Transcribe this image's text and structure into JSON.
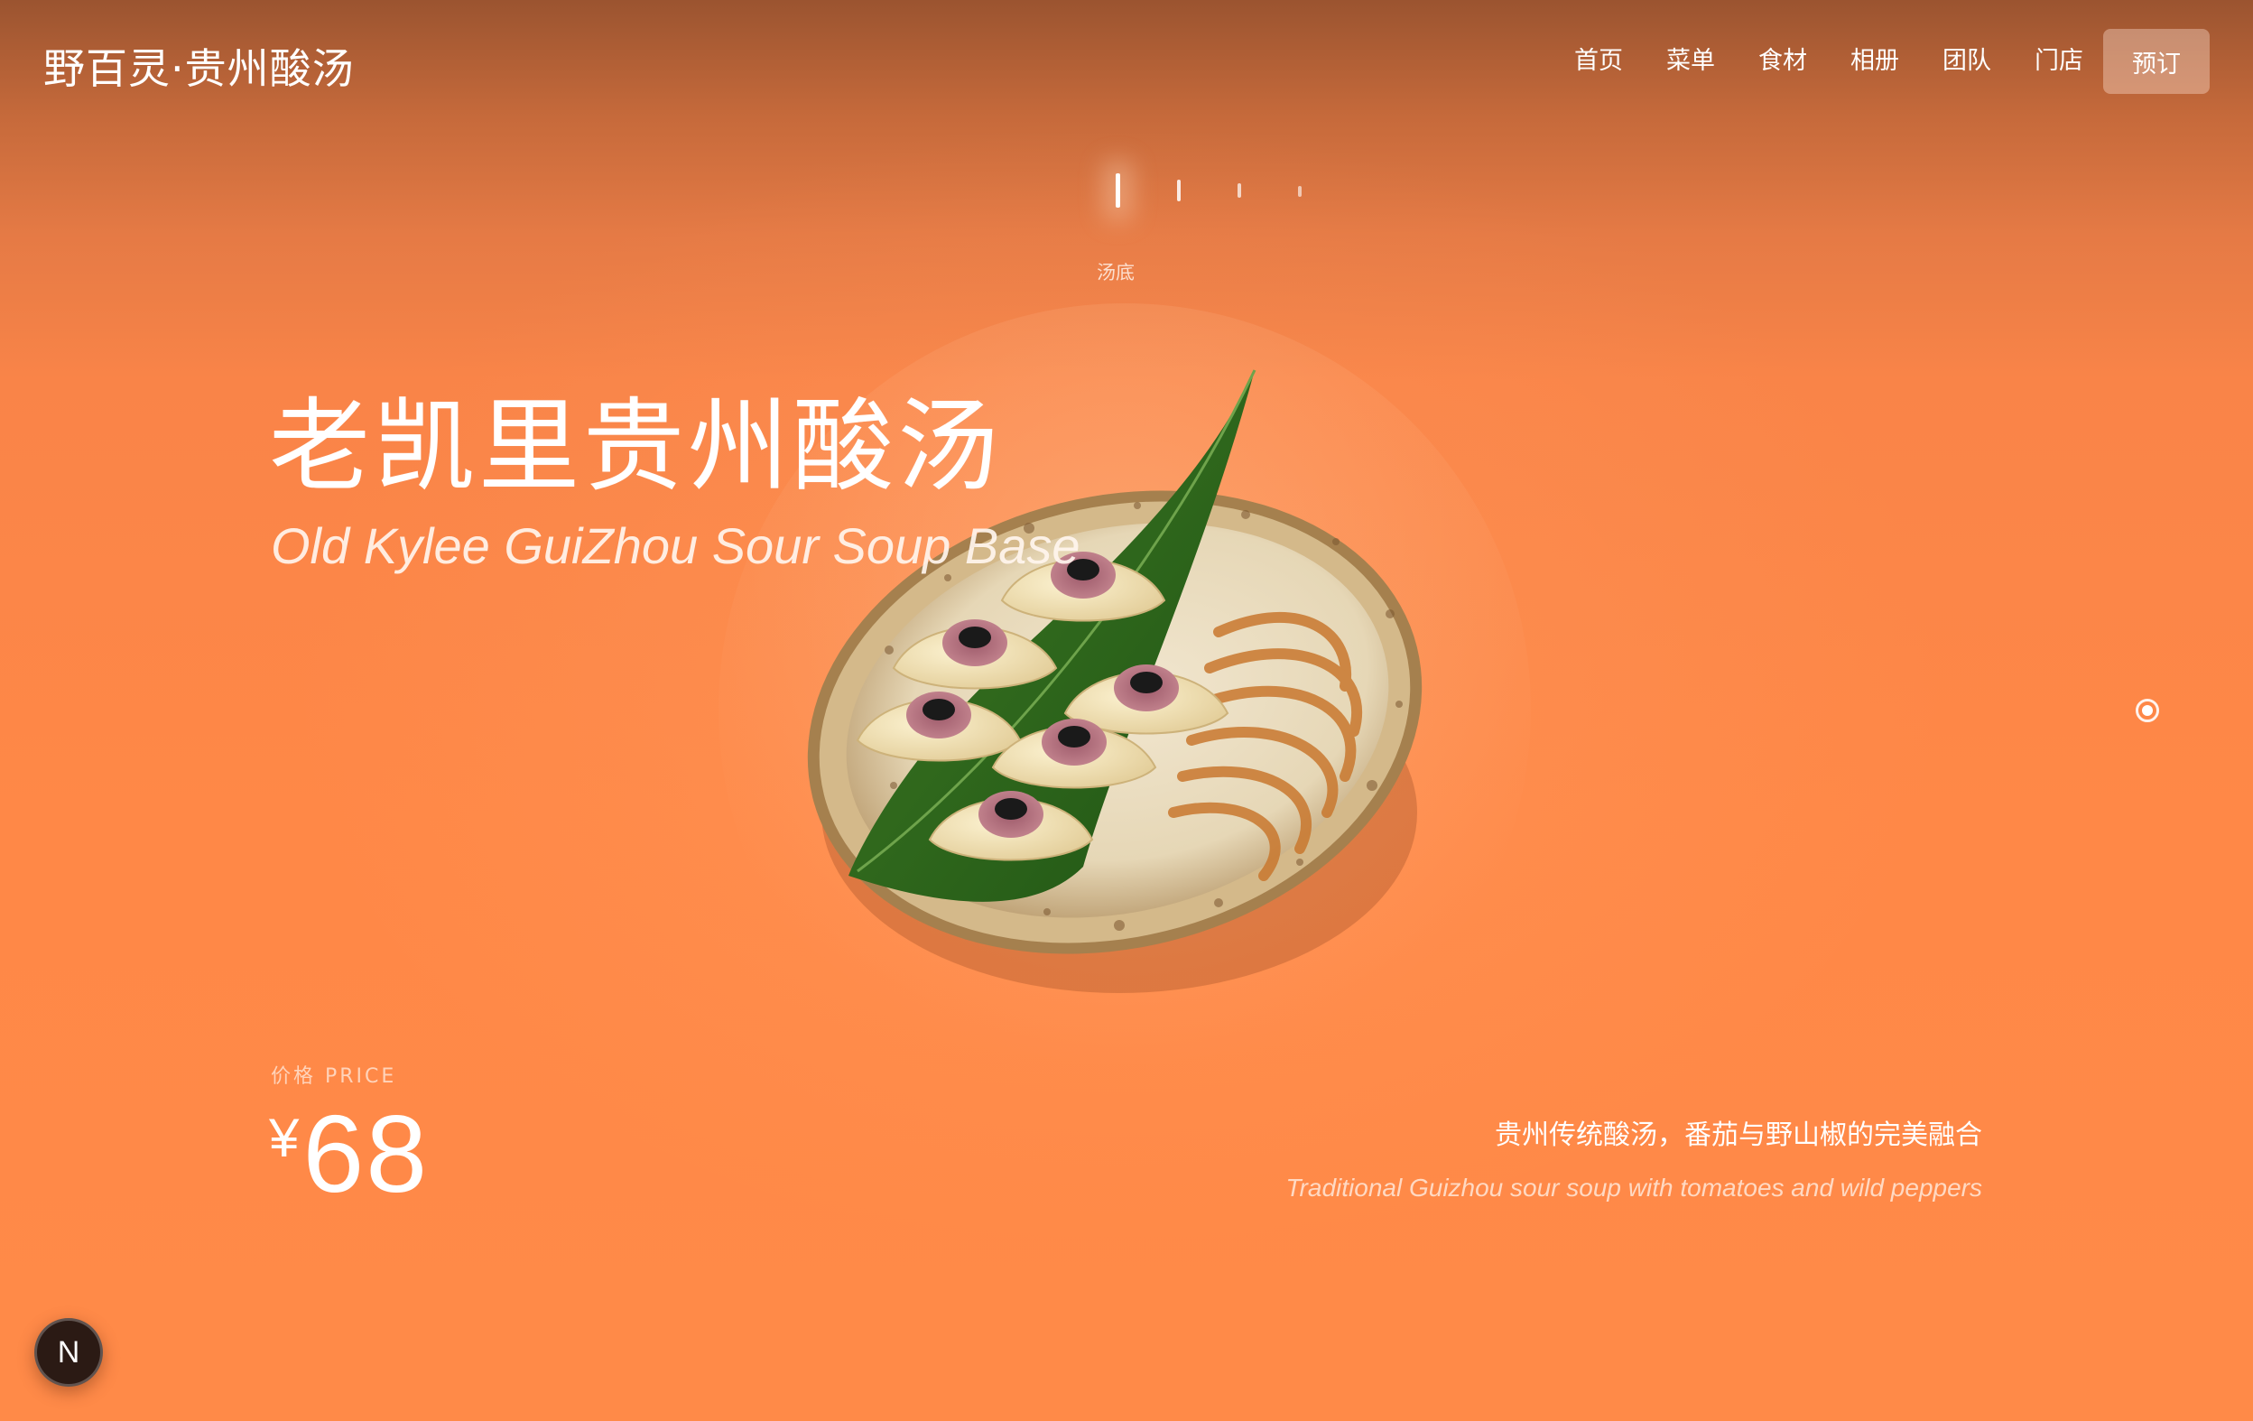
{
  "header": {
    "brand": "野百灵·贵州酸汤",
    "nav": [
      "首页",
      "菜单",
      "食材",
      "相册",
      "团队",
      "门店"
    ],
    "book_label": "预订"
  },
  "category": {
    "active_label": "汤底",
    "tick_count": 4,
    "active_index": 0
  },
  "dish": {
    "title_cn": "老凯里贵州酸汤",
    "title_en": "Old Kylee GuiZhou Sour Soup Base",
    "price_label": "价格 PRICE",
    "currency": "¥",
    "price": "68",
    "desc_cn": "贵州传统酸汤，番茄与野山椒的完美融合",
    "desc_en": "Traditional Guizhou sour soup with tomatoes and wild peppers",
    "image_icon": "dumpling-plate-image"
  },
  "side_indicator_icon": "scroll-position-dot-icon",
  "badge": {
    "letter": "N",
    "icon": "nextjs-badge-icon"
  },
  "colors": {
    "background_top": "#9b5430",
    "background_main": "#ff8847",
    "badge_bg": "#2b1a14"
  }
}
